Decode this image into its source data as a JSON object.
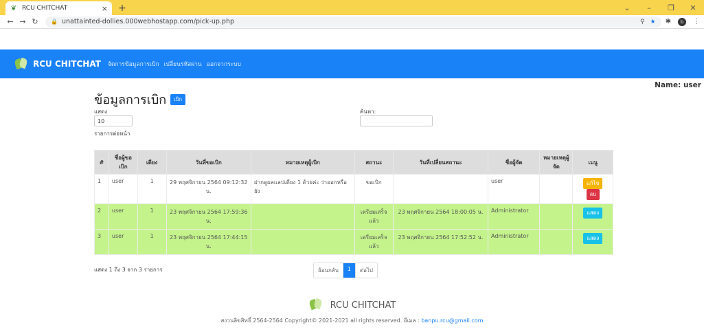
{
  "browser": {
    "tab_title": "RCU CHITCHAT",
    "url": "unattainted-dollies.000webhostapp.com/pick-up.php",
    "profile_initial": "b"
  },
  "nav": {
    "brand": "RCU CHITCHAT",
    "links": [
      "จัดการข้อมูลการเบิก",
      "เปลี่ยนรหัสผ่าน",
      "ออกจากระบบ"
    ]
  },
  "page": {
    "name_label": "Name: user",
    "title": "ข้อมูลการเบิก",
    "add_button": "เบิก",
    "show_label": "แสดง",
    "page_size": "10",
    "per_page_label": "รายการต่อหน้า",
    "search_label": "ค้นหา:",
    "search_value": ""
  },
  "table": {
    "headers": [
      "#",
      "ชื่อผู้ขอเบิก",
      "เตียง",
      "วันที่ขอเบิก",
      "หมายเหตุผู้เบิก",
      "สถานะ",
      "วันที่เปลี่ยนสถานะ",
      "ชื่อผู้จัด",
      "หมายเหตุผู้จัด",
      "เมนู"
    ],
    "rows": [
      {
        "no": "1",
        "requester": "user",
        "bed": "1",
        "request_date": "29 พฤศจิกายน 2564 09:12:32 น.",
        "note": "ฝากดูผลแลปเตียง 1 ด้วยค่ะ ว่าออกหรือยัง",
        "status": "ขอเบิก",
        "status_date": "",
        "handler": "user",
        "handler_note": "",
        "actions": [
          "แก้ไข",
          "ลบ"
        ]
      },
      {
        "no": "2",
        "requester": "user",
        "bed": "1",
        "request_date": "23 พฤศจิกายน 2564 17:59:36 น.",
        "note": "",
        "status": "เตรียมเสร็จแล้ว",
        "status_date": "23 พฤศจิกายน 2564 18:00:05 น.",
        "handler": "Administrator",
        "handler_note": "",
        "actions": [
          "แสดง"
        ]
      },
      {
        "no": "3",
        "requester": "user",
        "bed": "1",
        "request_date": "23 พฤศจิกายน 2564 17:44:15 น.",
        "note": "",
        "status": "เตรียมเสร็จแล้ว",
        "status_date": "23 พฤศจิกายน 2564 17:52:52 น.",
        "handler": "Administrator",
        "handler_note": "",
        "actions": [
          "แสดง"
        ]
      }
    ]
  },
  "pagination": {
    "info": "แสดง 1 ถึง 3 จาก 3 รายการ",
    "prev": "ย้อนกลับ",
    "current": "1",
    "next": "ต่อไป"
  },
  "footer": {
    "brand": "RCU CHITCHAT",
    "copyright": "สงวนลิขสิทธิ์ 2564-2564 Copyright© 2021-2021 all rights reserved. อีเมล :",
    "email": "banpu.rcu@gmail.com"
  },
  "colors": {
    "browser_bar": "#f8d34c",
    "navbar": "#1a82f7",
    "row_done": "#c4f38c"
  }
}
